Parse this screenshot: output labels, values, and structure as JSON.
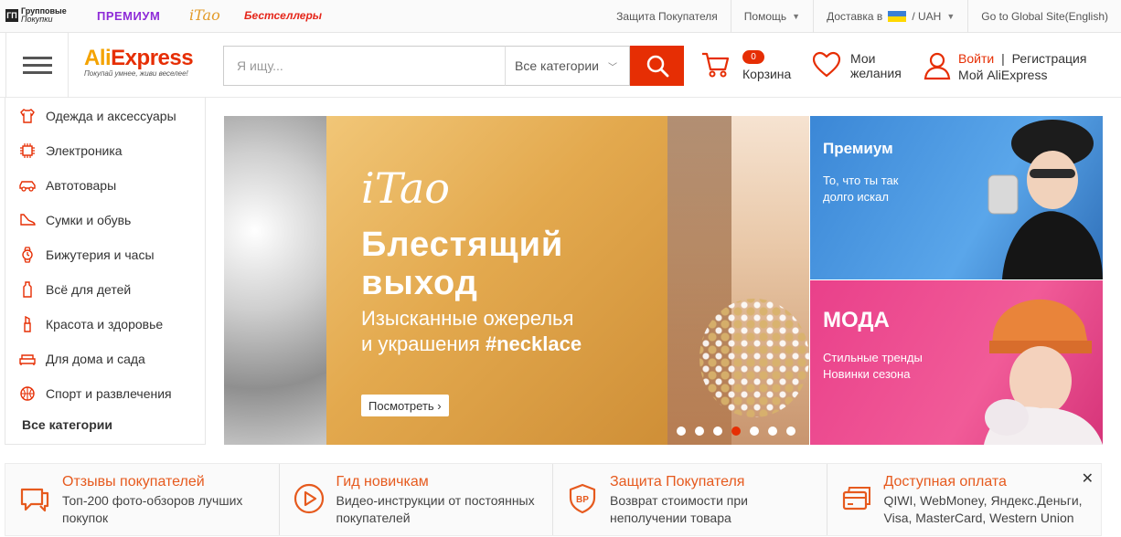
{
  "topbar": {
    "group_buy": {
      "icon_text": "ГП",
      "line1": "Групповые",
      "line2": "Покупки"
    },
    "premium": "ПРЕМИУМ",
    "itao": "iTao",
    "bestsellers": "Бестселлеры",
    "buyer_protection": "Защита Покупателя",
    "help": "Помощь",
    "delivery": "Доставка в",
    "currency_sep": "/",
    "currency": "UAH",
    "global_site": "Go to Global Site(English)"
  },
  "header": {
    "logo_main": "AliExpress",
    "logo_tagline": "Покупай умнее, живи веселее!",
    "search_placeholder": "Я ищу...",
    "category_select": "Все категории",
    "cart_count": "0",
    "cart_label": "Корзина",
    "wish_line1": "Мои",
    "wish_line2": "желания",
    "login": "Войти",
    "sep": "|",
    "register": "Регистрация",
    "my_account": "Мой AliExpress"
  },
  "sidebar": {
    "items": [
      {
        "label": "Одежда и аксессуары",
        "icon": "shirt-icon"
      },
      {
        "label": "Электроника",
        "icon": "chip-icon"
      },
      {
        "label": "Автотовары",
        "icon": "car-icon"
      },
      {
        "label": "Сумки и обувь",
        "icon": "shoe-icon"
      },
      {
        "label": "Бижутерия и часы",
        "icon": "watch-icon"
      },
      {
        "label": "Всё для детей",
        "icon": "bottle-icon"
      },
      {
        "label": "Красота и здоровье",
        "icon": "lipstick-icon"
      },
      {
        "label": "Для дома и сада",
        "icon": "sofa-icon"
      },
      {
        "label": "Спорт и развлечения",
        "icon": "ball-icon"
      }
    ],
    "all": "Все категории"
  },
  "banner": {
    "brand": "iTao",
    "headline_1": "Блестящий",
    "headline_2": "выход",
    "sub_1": "Изысканные ожерелья",
    "sub_2_prefix": "и украшения ",
    "sub_2_tag": "#necklace",
    "cta": "Посмотреть ›",
    "slide_count": 7,
    "active_slide": 4
  },
  "promos": [
    {
      "title": "Премиум",
      "line1": "То, что ты так",
      "line2": "долго искал"
    },
    {
      "title": "МОДА",
      "line1": "Стильные тренды",
      "line2": "Новинки сезона"
    }
  ],
  "features": [
    {
      "title": "Отзывы покупателей",
      "desc": "Топ-200 фото-обзоров лучших покупок",
      "icon": "chat-icon"
    },
    {
      "title": "Гид новичкам",
      "desc": "Видео-инструкции от постоянных покупателей",
      "icon": "play-icon"
    },
    {
      "title": "Защита Покупателя",
      "desc": "Возврат стоимости при неполучении товара",
      "icon": "shield-icon",
      "badge": "BP"
    },
    {
      "title": "Доступная оплата",
      "desc": "QIWI, WebMoney, Яндекс.Деньги, Visa, MasterCard, Western Union",
      "icon": "wallet-icon"
    }
  ],
  "close_glyph": "✕",
  "colors": {
    "accent": "#e62e04",
    "orange": "#e65a1e",
    "premium": "#8e2bd8"
  }
}
